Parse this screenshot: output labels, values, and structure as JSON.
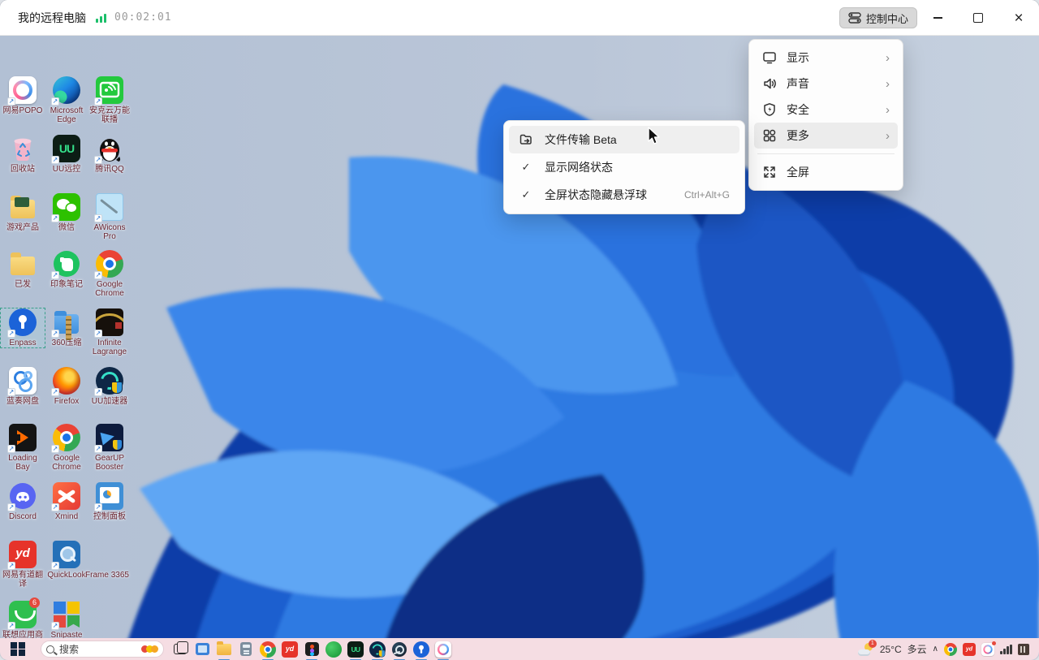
{
  "titlebar": {
    "title": "我的远程电脑",
    "timer": "00:02:01",
    "control_center_label": "控制中心"
  },
  "control_menu": {
    "items": [
      {
        "icon": "display-icon",
        "label": "显示",
        "has_submenu": true
      },
      {
        "icon": "sound-icon",
        "label": "声音",
        "has_submenu": true
      },
      {
        "icon": "security-icon",
        "label": "安全",
        "has_submenu": true
      },
      {
        "icon": "more-icon",
        "label": "更多",
        "has_submenu": true,
        "highlighted": true
      },
      {
        "icon": "fullscreen-icon",
        "label": "全屏",
        "has_submenu": false
      }
    ],
    "chevron": "›"
  },
  "submenu": {
    "items": [
      {
        "icon": "file-transfer-icon",
        "label": "文件传输 Beta",
        "highlighted": true
      },
      {
        "checked": true,
        "check_glyph": "✓",
        "label": "显示网络状态"
      },
      {
        "checked": true,
        "check_glyph": "✓",
        "label": "全屏状态隐藏悬浮球",
        "shortcut": "Ctrl+Alt+G"
      }
    ]
  },
  "desktop": {
    "icons": [
      {
        "label": "网易POPO"
      },
      {
        "label": "Microsoft Edge"
      },
      {
        "label": "安克云万能联播"
      },
      {
        "label": "回收站"
      },
      {
        "label": "UU远控",
        "icon_text": "UU"
      },
      {
        "label": "腾讯QQ"
      },
      {
        "label": "游戏产品"
      },
      {
        "label": "微信"
      },
      {
        "label": "AWicons Pro"
      },
      {
        "label": "已发"
      },
      {
        "label": "印象笔记"
      },
      {
        "label": "Google Chrome"
      },
      {
        "label": "Enpass",
        "selected": true
      },
      {
        "label": "360压缩"
      },
      {
        "label": "Infinite Lagrange"
      },
      {
        "label": "蓝奏网盘"
      },
      {
        "label": "Firefox"
      },
      {
        "label": "UU加速器"
      },
      {
        "label": "Loading Bay"
      },
      {
        "label": "Google Chrome"
      },
      {
        "label": "GearUP Booster"
      },
      {
        "label": "Discord"
      },
      {
        "label": "Xmind"
      },
      {
        "label": "控制面板"
      },
      {
        "label": "网易有道翻译",
        "icon_text": "yd"
      },
      {
        "label": "QuickLook"
      },
      {
        "label": "Frame 3365"
      },
      {
        "label": "联想应用商店",
        "badge": "6"
      },
      {
        "label": "Snipaste"
      }
    ]
  },
  "taskbar": {
    "search_placeholder": "搜索",
    "pinned": [
      "start",
      "task-view",
      "photos",
      "file-explorer",
      "calculator",
      "chrome",
      "youdao",
      "figma",
      "green-app",
      "uu-remote",
      "uu-booster",
      "steam",
      "enpass",
      "popo"
    ],
    "open_apps": [
      "file-explorer",
      "chrome",
      "figma",
      "uu-remote",
      "uu-booster",
      "steam",
      "enpass",
      "popo"
    ]
  },
  "tray": {
    "weather_badge": "1",
    "temperature": "25°C",
    "condition": "多云",
    "chevron": "∧",
    "icons": [
      "chrome",
      "youdao",
      "popo",
      "network",
      "ime"
    ]
  }
}
